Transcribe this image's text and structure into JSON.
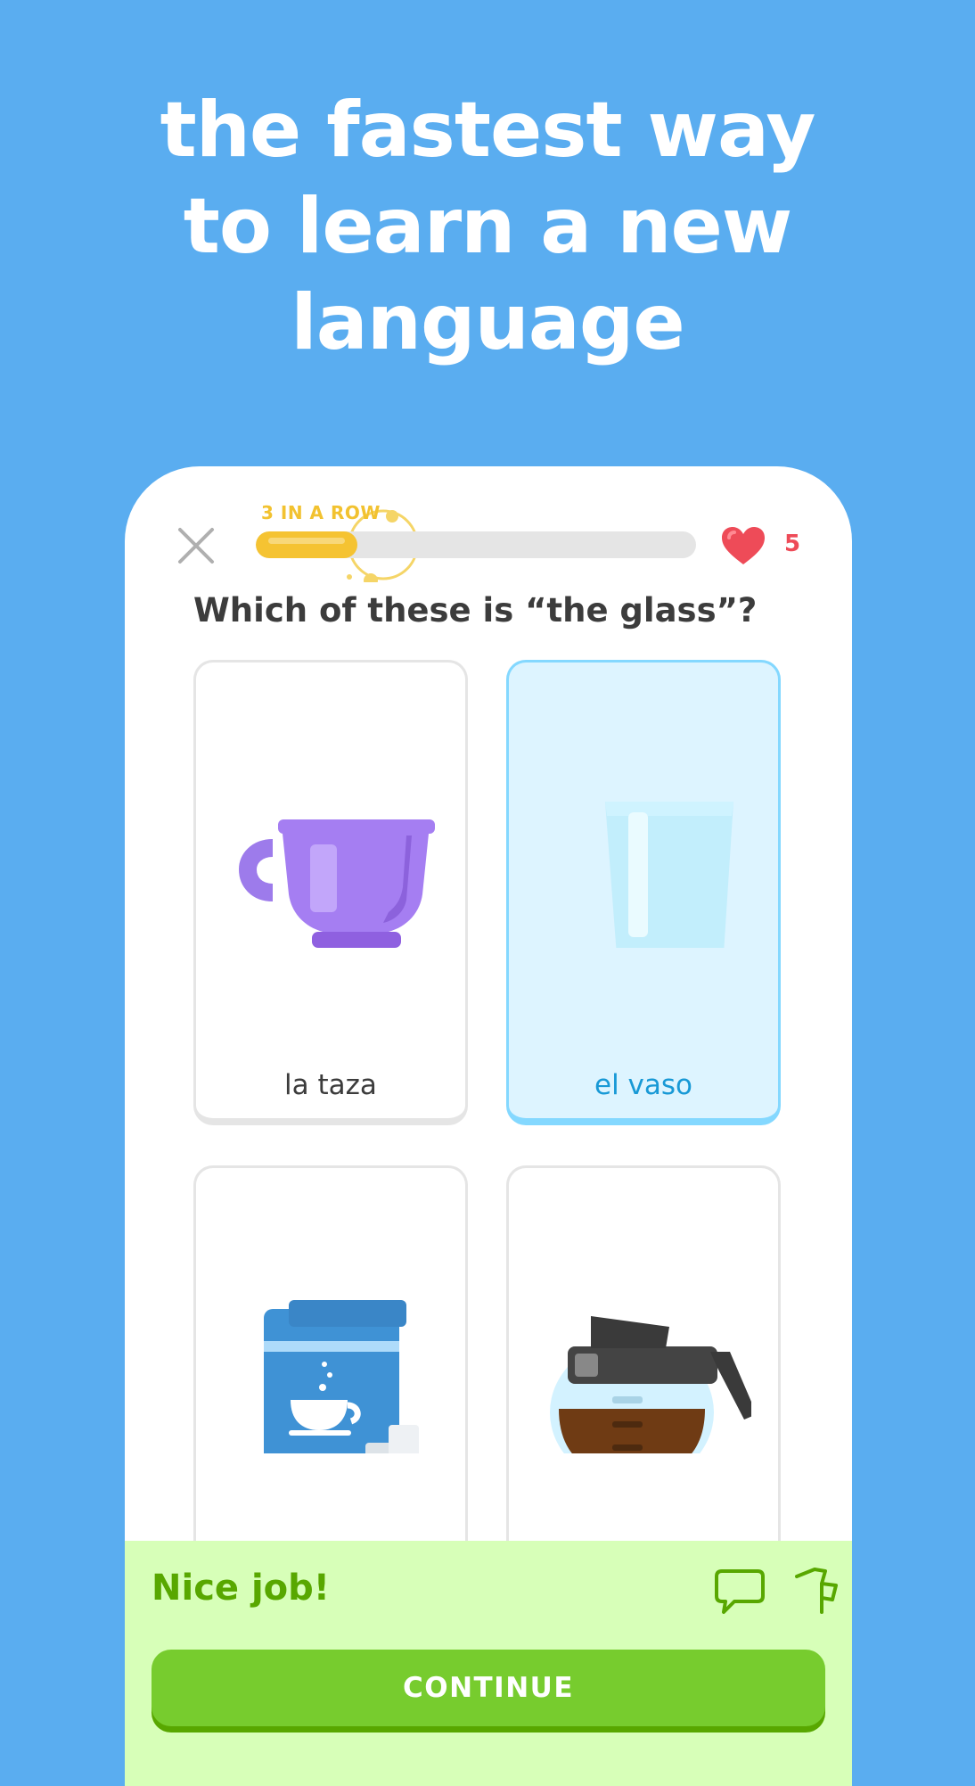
{
  "headline": {
    "lines": [
      "the fastest way",
      "to learn a new",
      "language"
    ]
  },
  "lesson": {
    "streak_label": "3 IN A ROW",
    "progress": 0.23,
    "hearts": "5",
    "question": "Which of these is “the glass”?",
    "choices": [
      {
        "label": "la taza",
        "icon": "purple-cup-icon",
        "selected": false
      },
      {
        "label": "el vaso",
        "icon": "glass-icon",
        "selected": true
      },
      {
        "label": "",
        "icon": "coffee-bag-icon",
        "selected": false
      },
      {
        "label": "",
        "icon": "coffee-pot-icon",
        "selected": false
      }
    ],
    "feedback": {
      "message": "Nice job!",
      "continue_label": "CONTINUE"
    }
  },
  "colors": {
    "background": "#5AADF0",
    "streak": "#F5C332",
    "heart": "#EE4B58",
    "success_bg": "#D7FFB8",
    "success_text": "#58A700",
    "button": "#77CC2E",
    "selected_card": "#DDF4FF"
  }
}
